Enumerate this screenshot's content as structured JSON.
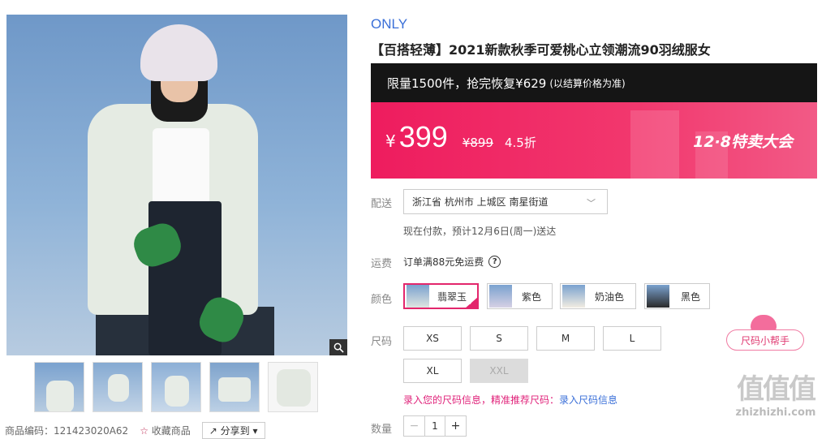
{
  "gallery": {
    "zoom_icon": "magnifier-icon",
    "thumbnails": [
      {
        "name": "thumb-1"
      },
      {
        "name": "thumb-2"
      },
      {
        "name": "thumb-3"
      },
      {
        "name": "thumb-4"
      },
      {
        "name": "thumb-5"
      }
    ],
    "product_code_label": "商品编码：121423020A62",
    "favorite_label": "收藏商品",
    "share_label": "分享到"
  },
  "product": {
    "brand": "ONLY",
    "title": "【百搭轻薄】2021新款秋季可爱桃心立领潮流90羽绒服女"
  },
  "promo": {
    "headline": "限量1500件，抢完恢复¥629",
    "note": "(以结算价格为准)",
    "currency": "¥",
    "price": "399",
    "original_price": "¥899",
    "discount": "4.5折",
    "event": "12·8特卖大会",
    "colors": {
      "banner": "#ee1c5e",
      "top_bar": "#151515"
    }
  },
  "shipping": {
    "label": "配送",
    "address": "浙江省 杭州市 上城区 南星街道",
    "eta": "现在付款，预计12月6日(周一)送达"
  },
  "freight": {
    "label": "运费",
    "text": "订单满88元免运费",
    "help_icon": "?"
  },
  "colors_section": {
    "label": "颜色",
    "options": [
      {
        "name": "翡翠玉",
        "selected": true
      },
      {
        "name": "紫色",
        "selected": false
      },
      {
        "name": "奶油色",
        "selected": false
      },
      {
        "name": "黑色",
        "selected": false
      }
    ]
  },
  "sizes_section": {
    "label": "尺码",
    "options": [
      {
        "name": "XS",
        "available": true
      },
      {
        "name": "S",
        "available": true
      },
      {
        "name": "M",
        "available": true
      },
      {
        "name": "L",
        "available": true
      },
      {
        "name": "XL",
        "available": true
      },
      {
        "name": "XXL",
        "available": false
      }
    ],
    "helper": "尺码小帮手",
    "tip_text": "录入您的尺码信息，精准推荐尺码：",
    "tip_link": "录入尺码信息"
  },
  "quantity": {
    "label": "数量",
    "value": "1",
    "minus": "−",
    "plus": "+"
  },
  "watermark": {
    "main": "值值值",
    "url": "zhizhizhi.com"
  },
  "accent_color": "#e3266c"
}
